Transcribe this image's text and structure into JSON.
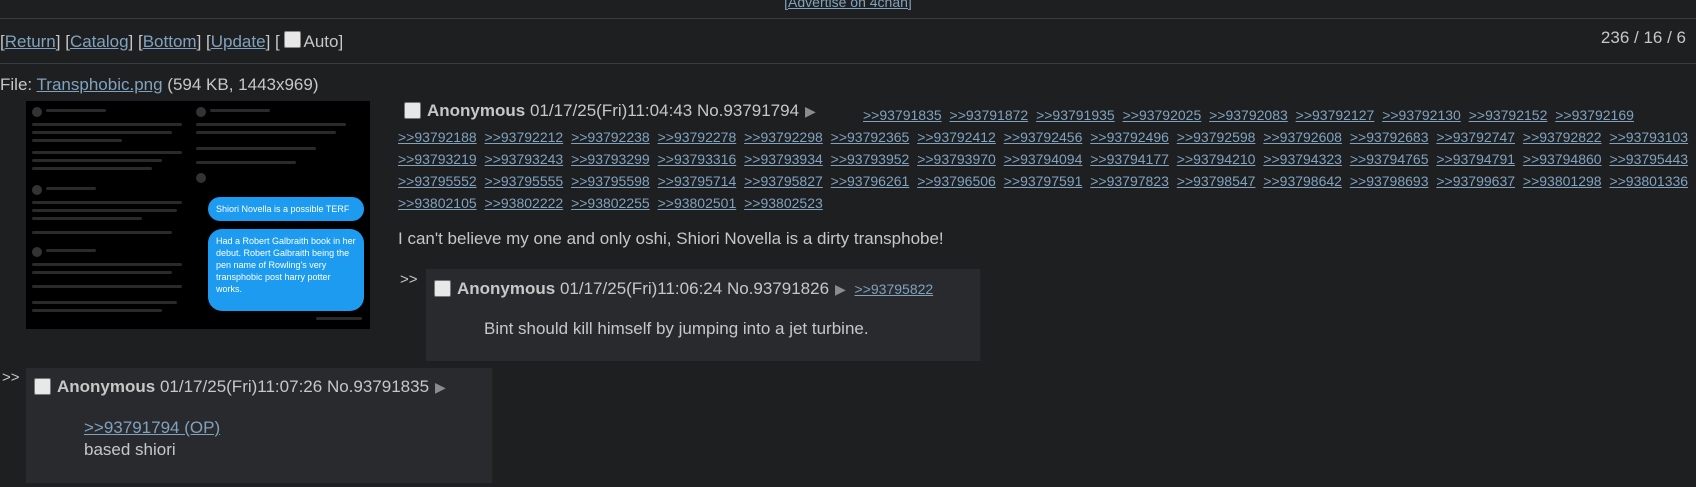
{
  "top_ad": "[Advertise on 4chan]",
  "nav": {
    "return_label": "Return",
    "catalog_label": "Catalog",
    "bottom_label": "Bottom",
    "update_label": "Update",
    "auto_label": "Auto"
  },
  "stats": "236 / 16 / 6",
  "op": {
    "file_prefix": "File: ",
    "file_name": "Transphobic.png",
    "file_meta": " (594 KB, 1443x969)",
    "name": "Anonymous",
    "datetime": "01/17/25(Fri)11:04:43",
    "number": "No.93791794",
    "backlinks": [
      ">>93791835",
      ">>93791872",
      ">>93791935",
      ">>93792025",
      ">>93792083",
      ">>93792127",
      ">>93792130",
      ">>93792152",
      ">>93792169",
      ">>93792188",
      ">>93792212",
      ">>93792238",
      ">>93792278",
      ">>93792298",
      ">>93792365",
      ">>93792412",
      ">>93792456",
      ">>93792496",
      ">>93792598",
      ">>93792608",
      ">>93792683",
      ">>93792747",
      ">>93792822",
      ">>93793103",
      ">>93793219",
      ">>93793243",
      ">>93793299",
      ">>93793316",
      ">>93793934",
      ">>93793952",
      ">>93793970",
      ">>93794094",
      ">>93794177",
      ">>93794210",
      ">>93794323",
      ">>93794765",
      ">>93794791",
      ">>93794860",
      ">>93795443",
      ">>93795552",
      ">>93795555",
      ">>93795598",
      ">>93795714",
      ">>93795827",
      ">>93796261",
      ">>93796506",
      ">>93797591",
      ">>93797823",
      ">>93798547",
      ">>93798642",
      ">>93798693",
      ">>93799637",
      ">>93801298",
      ">>93801336",
      ">>93802105",
      ">>93802222",
      ">>93802255",
      ">>93802501",
      ">>93802523"
    ],
    "comment": "I can't believe my one and only oshi, Shiori Novella is a dirty transphobe!",
    "thumb_bubble_1": "Shiori Novella is a possible TERF",
    "thumb_bubble_2": "Had a Robert Galbraith book in her debut. Robert Galbraith being the pen name of Rowling's very transphobic post harry potter works."
  },
  "reply1": {
    "side": ">>",
    "name": "Anonymous",
    "datetime": "01/17/25(Fri)11:06:24",
    "number": "No.93791826",
    "backlink": ">>93795822",
    "comment": "Bint should kill himself by jumping into a jet turbine."
  },
  "reply2": {
    "side": ">>",
    "name": "Anonymous",
    "datetime": "01/17/25(Fri)11:07:26",
    "number": "No.93791835",
    "quote": ">>93791794 (OP)",
    "comment": "based shiori"
  },
  "icons": {
    "arrow": "play-arrow-icon",
    "checkbox": "checkbox-icon"
  },
  "colors": {
    "background": "#1d1f21",
    "reply_bg": "#282a2e",
    "text": "#c5c8c6",
    "link": "#81a2be"
  }
}
